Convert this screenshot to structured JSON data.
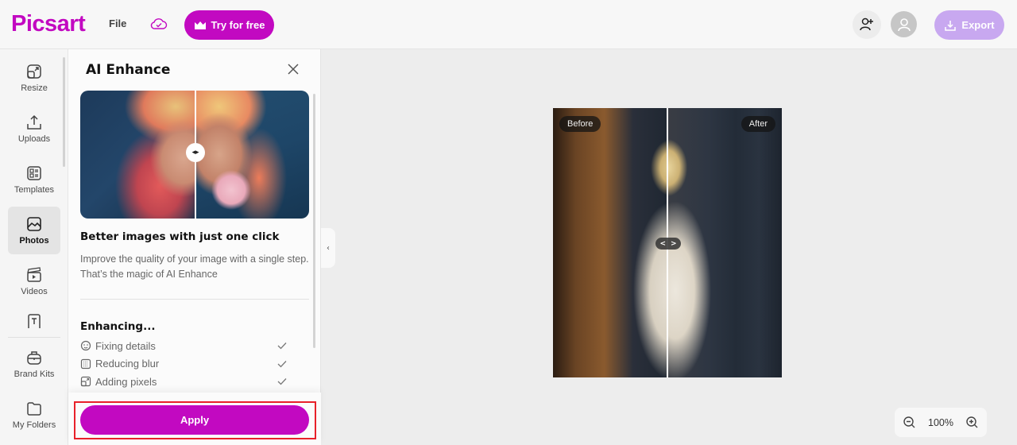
{
  "header": {
    "logo": "Picsart",
    "file_menu": "File",
    "try_button": "Try for free",
    "export_button": "Export",
    "brand_color": "#c209c1",
    "export_color": "#c8a8f0"
  },
  "rail": {
    "items": [
      {
        "label": "Resize",
        "icon": "resize-icon",
        "active": false
      },
      {
        "label": "Uploads",
        "icon": "upload-icon",
        "active": false
      },
      {
        "label": "Templates",
        "icon": "templates-icon",
        "active": false
      },
      {
        "label": "Photos",
        "icon": "photos-icon",
        "active": true
      },
      {
        "label": "Videos",
        "icon": "videos-icon",
        "active": false
      },
      {
        "label": "",
        "icon": "text-icon",
        "active": false
      },
      {
        "label": "Brand Kits",
        "icon": "brand-kit-icon",
        "active": false
      },
      {
        "label": "My Folders",
        "icon": "folder-icon",
        "active": false
      }
    ]
  },
  "panel": {
    "title": "AI Enhance",
    "subtitle": "Better images with just one click",
    "description": "Improve the quality of your image with a single step. That’s the magic of AI Enhance",
    "enhancing_title": "Enhancing...",
    "steps": [
      {
        "label": "Fixing details",
        "icon": "face-icon",
        "done": true
      },
      {
        "label": "Reducing blur",
        "icon": "blur-icon",
        "done": true
      },
      {
        "label": "Adding pixels",
        "icon": "pixels-icon",
        "done": true
      }
    ],
    "apply_button": "Apply"
  },
  "canvas": {
    "before_label": "Before",
    "after_label": "After",
    "zoom_level": "100%"
  }
}
